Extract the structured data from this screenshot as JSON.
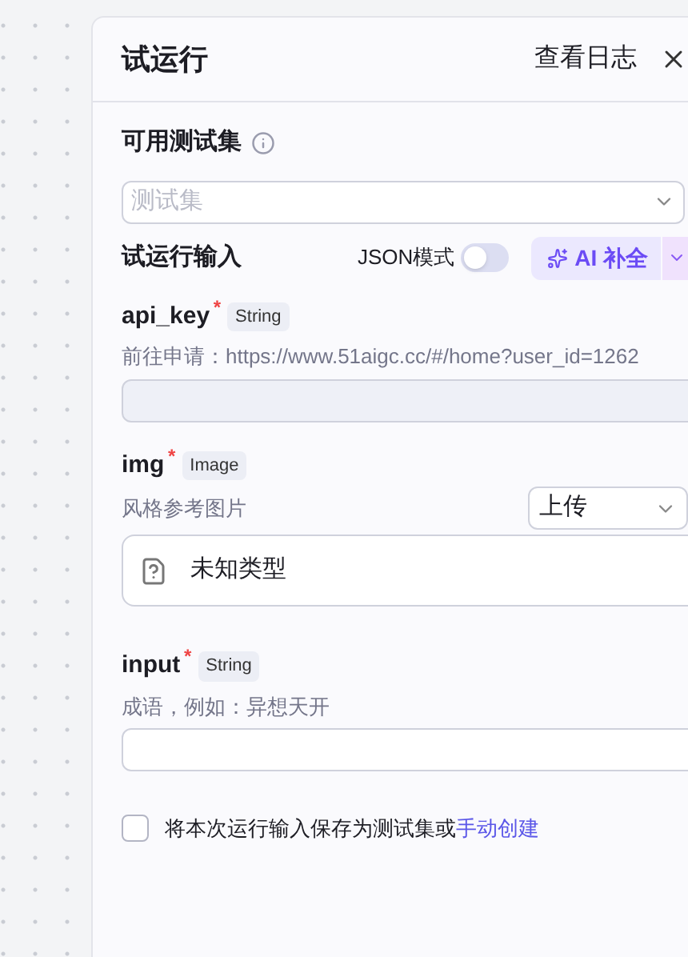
{
  "header": {
    "title": "试运行",
    "log_link": "查看日志"
  },
  "test_set": {
    "label": "可用测试集",
    "placeholder": "测试集"
  },
  "run_input": {
    "label": "试运行输入",
    "json_mode": {
      "label": "JSON模式",
      "on": false
    },
    "ai_button": "AI 补全"
  },
  "params": [
    {
      "kind": "text",
      "name": "api_key",
      "required_mark": "*",
      "type": "String",
      "description": "前往申请：https://www.51aigc.cc/#/home?user_id=1262",
      "filled": true
    },
    {
      "kind": "image",
      "name": "img",
      "required_mark": "*",
      "type": "Image",
      "description": "风格参考图片",
      "source": "上传",
      "file": "未知类型"
    },
    {
      "kind": "text",
      "name": "input",
      "required_mark": "*",
      "type": "String",
      "description": "成语，例如：异想天开",
      "filled": false
    }
  ],
  "save": {
    "checked": false,
    "text": "将本次运行输入保存为测试集或",
    "link": "手动创建"
  }
}
